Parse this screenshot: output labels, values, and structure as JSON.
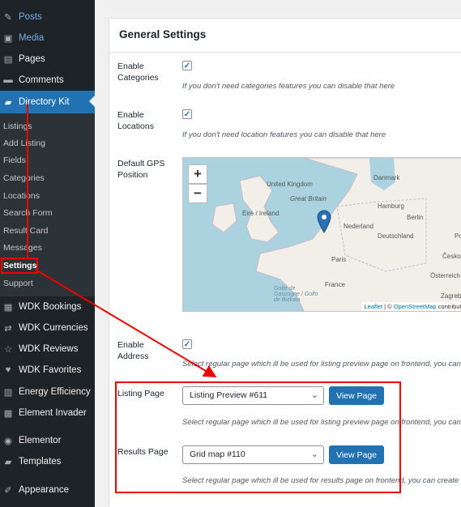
{
  "sidebar": {
    "top_items": [
      {
        "label": "Posts",
        "icon": "pin-icon"
      },
      {
        "label": "Media",
        "icon": "media-icon"
      },
      {
        "label": "Pages",
        "icon": "pages-icon"
      },
      {
        "label": "Comments",
        "icon": "comments-icon"
      },
      {
        "label": "Directory Kit",
        "icon": "folder-icon"
      }
    ],
    "sub_items": [
      "Listings",
      "Add Listing",
      "Fields",
      "Categories",
      "Locations",
      "Search Form",
      "Result Card",
      "Messages",
      "Settings",
      "Support"
    ],
    "bottom_items": [
      {
        "label": "WDK Bookings",
        "icon": "calendar-icon"
      },
      {
        "label": "WDK Currencies",
        "icon": "currency-icon"
      },
      {
        "label": "WDK Reviews",
        "icon": "star-icon"
      },
      {
        "label": "WDK Favorites",
        "icon": "heart-icon"
      },
      {
        "label": "Energy Efficiency",
        "icon": "bars-icon"
      },
      {
        "label": "Element Invader",
        "icon": "grid-icon"
      },
      {
        "label": "Elementor",
        "icon": "elementor-icon"
      },
      {
        "label": "Templates",
        "icon": "folder-icon"
      },
      {
        "label": "Appearance",
        "icon": "brush-icon"
      }
    ]
  },
  "panel": {
    "title": "General Settings",
    "enable_categories": {
      "label_1": "Enable",
      "label_2": "Categories",
      "checked": true,
      "desc": "If you don't need categories features you can disable that here"
    },
    "enable_locations": {
      "label_1": "Enable",
      "label_2": "Locations",
      "checked": true,
      "desc": "If you don't need location features you can disable that here"
    },
    "gps": {
      "label_1": "Default GPS",
      "label_2": "Position"
    },
    "map": {
      "labels": [
        "United Kingdom",
        "Great Britain",
        "Éire / Ireland",
        "Danmark",
        "Hamburg",
        "Berlin",
        "Nederland",
        "Deutschland",
        "Polsk",
        "Paris",
        "France",
        "Česko",
        "Österreich",
        "Zagreb",
        "Golfe de Gascogne / Golfo de Bizkaia"
      ],
      "attribution_leaflet": "Leaflet",
      "attribution_sep": " | © ",
      "attribution_osm": "OpenStreetMap",
      "attribution_tail": " contributors",
      "zoom_in": "+",
      "zoom_out": "−"
    },
    "enable_address": {
      "label_1": "Enable",
      "label_2": "Address",
      "checked": true,
      "desc": "Select regular page which ill be used for listing preview page on frontend, you can"
    },
    "listing_page": {
      "label": "Listing Page",
      "value": "Listing Preview #611",
      "button": "View Page",
      "desc": "Select regular page which ill be used for listing preview page on frontend, you can"
    },
    "results_page": {
      "label": "Results Page",
      "value": "Grid map #110",
      "button": "View Page",
      "desc": "Select regular page which ill be used for results page on frontend, you can create"
    }
  },
  "colors": {
    "accent": "#2271b1",
    "annotation": "#e00000",
    "sidebar": "#1d2327"
  }
}
